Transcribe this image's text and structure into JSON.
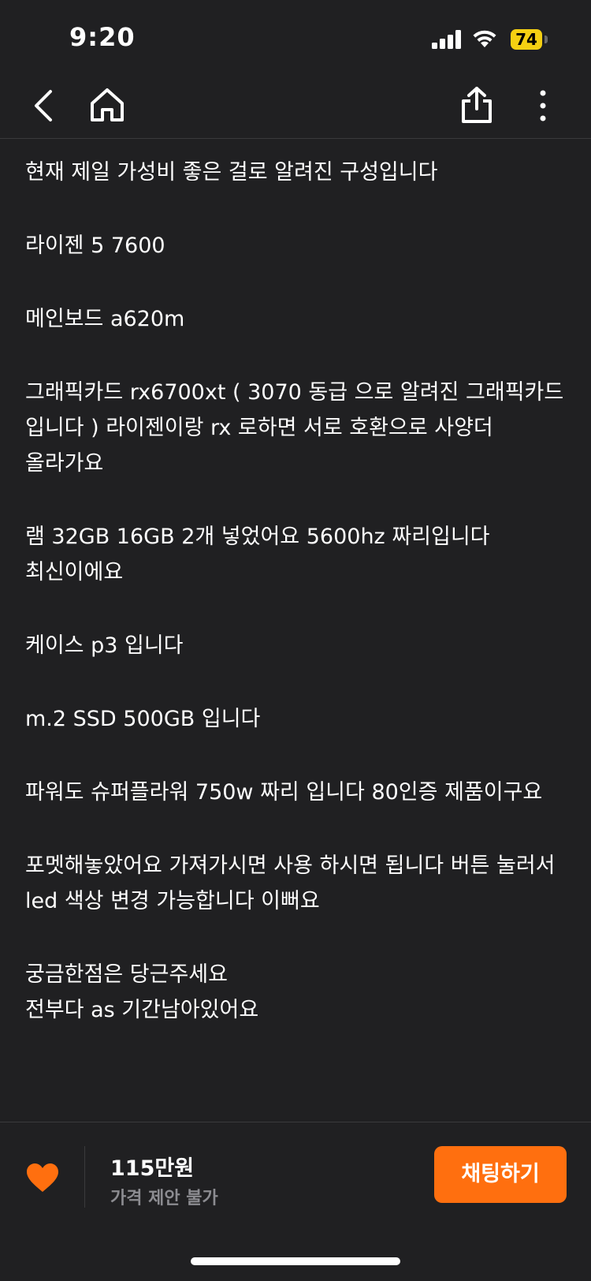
{
  "status_bar": {
    "time": "9:20",
    "battery": "74",
    "icons": [
      "cellular-signal-icon",
      "wifi-icon",
      "battery-icon"
    ]
  },
  "nav": {
    "icons": [
      "back-chevron-icon",
      "home-icon",
      "share-icon",
      "more-vertical-icon"
    ]
  },
  "description": {
    "paragraphs": [
      [
        "현재 제일 가성비 좋은 걸로 알려진 구성입니다"
      ],
      [
        "라이젠 5 7600"
      ],
      [
        "메인보드 a620m"
      ],
      [
        "그래픽카드 rx6700xt ( 3070 동급 으로 알려진 그래픽카드 입니다 ) 라이젠이랑 rx 로하면 서로 호환으로 사양더 올라가요"
      ],
      [
        "램 32GB 16GB 2개 넣었어요 5600hz 짜리입니다 최신이에요"
      ],
      [
        "케이스 p3 입니다"
      ],
      [
        "m.2 SSD 500GB 입니다"
      ],
      [
        "파워도 슈퍼플라워 750w 짜리 입니다 80인증 제품이구요"
      ],
      [
        "포멧해놓았어요 가져가시면 사용 하시면 됩니다 버튼 눌러서 led 색상 변경 가능합니다 이뻐요"
      ],
      [
        "궁금한점은 당근주세요",
        "전부다 as 기간남아있어요"
      ]
    ]
  },
  "bottom_bar": {
    "price": "115만원",
    "price_note": "가격 제안 불가",
    "chat_button": "채팅하기",
    "heart_icon": "heart-icon"
  },
  "colors": {
    "background": "#202022",
    "accent": "#ff6f0f",
    "battery": "#f5d012",
    "muted_text": "#8c8c91",
    "divider": "#3a3a3c"
  }
}
